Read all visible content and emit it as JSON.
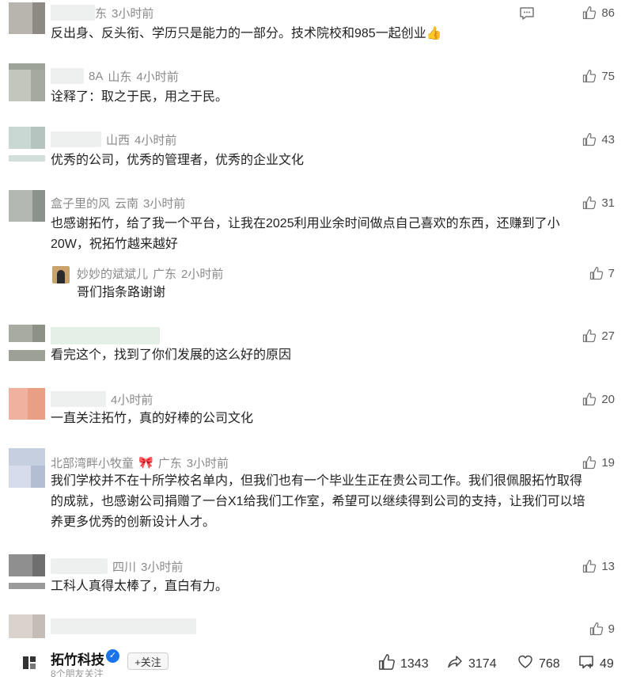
{
  "comments": [
    {
      "name": "东",
      "location": "",
      "time": "3小时前",
      "text": "反出身、反头衔、学历只是能力的一部分。技术院校和985一起创业👍",
      "likes": "86"
    },
    {
      "name": "8A",
      "location": "山东",
      "time": "4小时前",
      "text": "诠释了：取之于民，用之于民。",
      "likes": "75"
    },
    {
      "name": "",
      "location": "山西",
      "time": "4小时前",
      "text": "优秀的公司，优秀的管理者，优秀的企业文化",
      "likes": "43"
    },
    {
      "name": "盒子里的风",
      "location": "云南",
      "time": "3小时前",
      "text_line1": "也感谢拓竹，给了我一个平台，让我在2025利用业余时间做点自己喜欢的东西，还赚到了小",
      "text_line2": "20W，祝拓竹越来越好",
      "likes": "31",
      "reply": {
        "name": "妙妙的斌斌儿",
        "location": "广东",
        "time": "2小时前",
        "text": "哥们指条路谢谢",
        "likes": "7"
      }
    },
    {
      "name": "",
      "location": "",
      "time": "",
      "text": "看完这个，找到了你们发展的这么好的原因",
      "likes": "27"
    },
    {
      "name": "",
      "location": "",
      "time": "4小时前",
      "text": "一直关注拓竹，真的好棒的公司文化",
      "likes": "20"
    },
    {
      "name": "北部湾畔小牧童",
      "badge": "🎀",
      "location": "广东",
      "time": "3小时前",
      "text_line1": "我们学校并不在十所学校名单内，但我们也有一个毕业生正在贵公司工作。我们很佩服拓竹取得",
      "text_line2": "的成就，也感谢公司捐赠了一台X1给我们工作室，希望可以继续得到公司的支持，让我们可以培",
      "text_line3": "养更多优秀的创新设计人才。",
      "likes": "19"
    },
    {
      "name": "",
      "location": "四川",
      "time": "3小时前",
      "text": "工科人真得太棒了，直白有力。",
      "likes": "13"
    },
    {
      "name": "",
      "location": "",
      "time": "",
      "text": "",
      "likes": "9"
    }
  ],
  "footer": {
    "brand": "拓竹科技",
    "follow": "+关注",
    "friends": "8个朋友关注",
    "likes": "1343",
    "shares": "3174",
    "favorites": "768",
    "comments": "49"
  },
  "colors": {
    "accent": "#1a73e8",
    "meta": "#8a8a8a"
  },
  "icons": [
    "reply-icon",
    "thumb-up-icon",
    "share-icon",
    "heart-icon",
    "comment-icon",
    "verified-icon",
    "brand-logo"
  ]
}
